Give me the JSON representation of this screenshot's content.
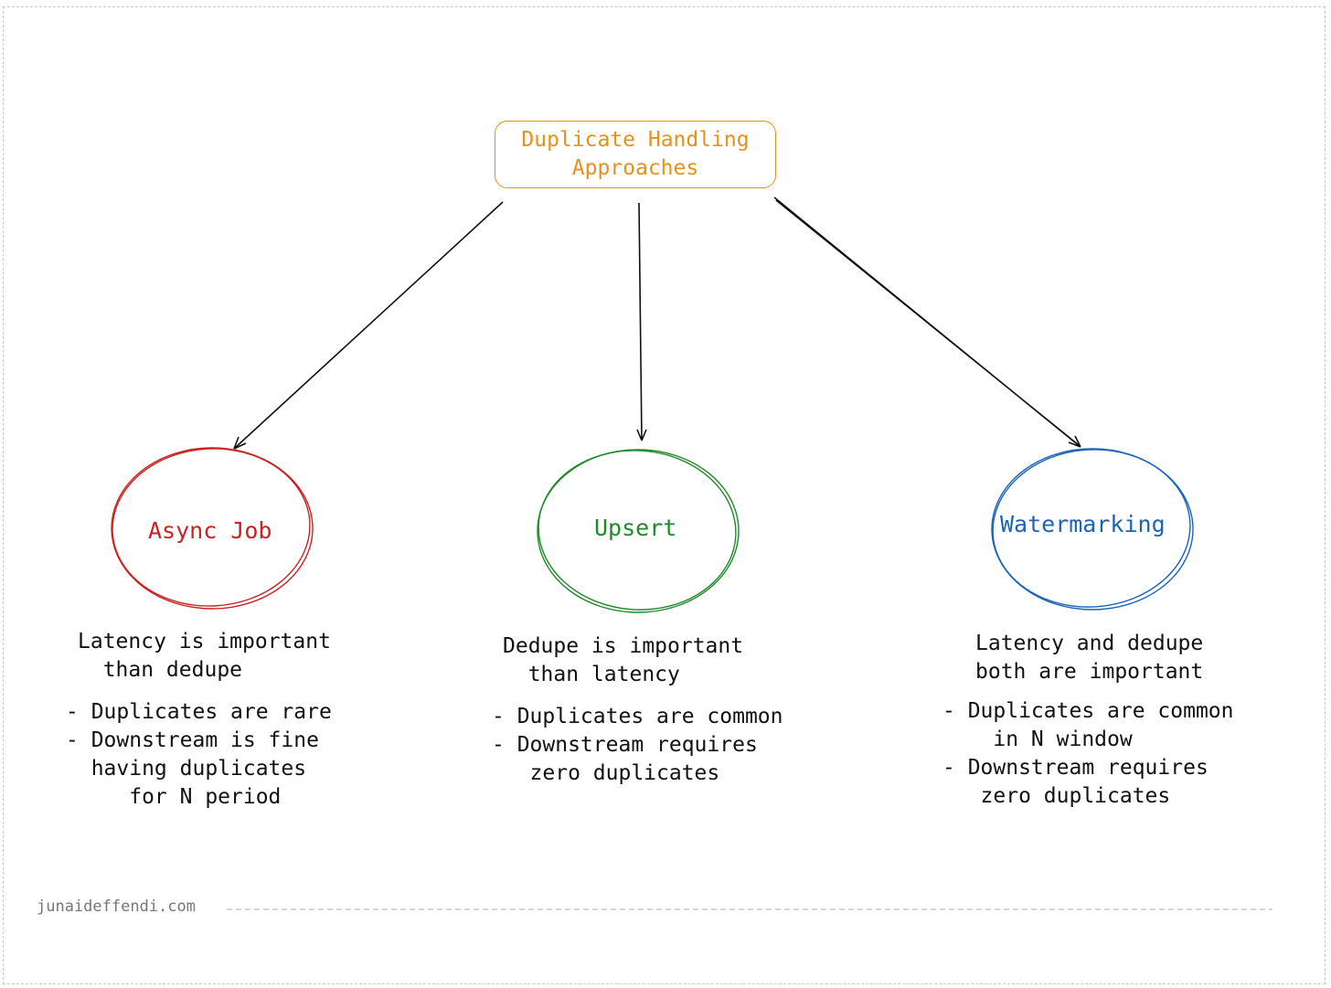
{
  "title": "Duplicate Handling\nApproaches",
  "colors": {
    "title": "#e8901a",
    "async": "#cc2222",
    "upsert": "#1f8a2a",
    "watermark": "#1b64b8"
  },
  "nodes": [
    {
      "label": "Async Job",
      "description": "Latency is important\n  than dedupe",
      "bullets": "- Duplicates are rare\n- Downstream is fine\n  having duplicates\n     for N period"
    },
    {
      "label": "Upsert",
      "description": "Dedupe is important\n  than latency",
      "bullets": "- Duplicates are common\n- Downstream requires\n   zero duplicates"
    },
    {
      "label": "Watermarking",
      "description": "Latency and dedupe\nboth are important",
      "bullets": "- Duplicates are common\n    in N window\n- Downstream requires\n   zero duplicates"
    }
  ],
  "footer": "junaideffendi.com"
}
